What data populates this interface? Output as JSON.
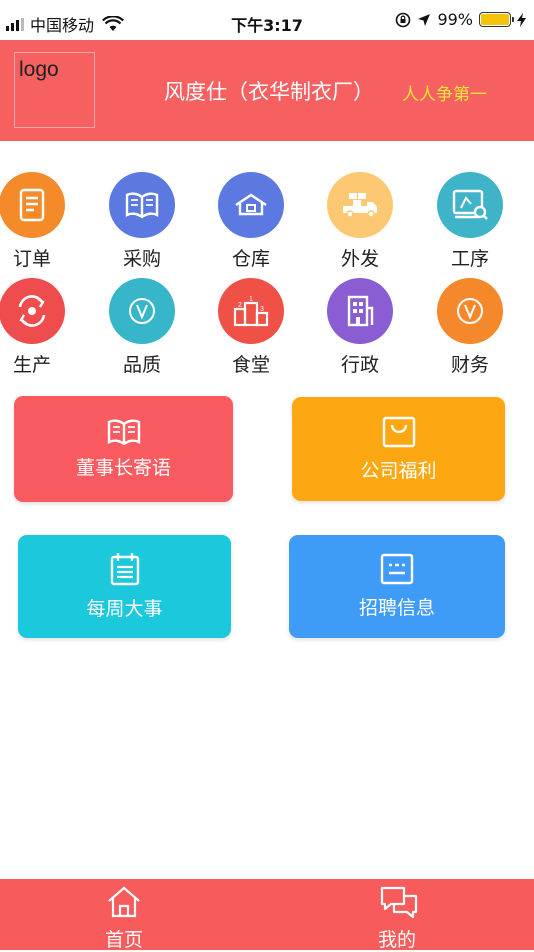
{
  "status_bar": {
    "carrier": "中国移动",
    "time": "下午3:17",
    "battery_percent": "99%"
  },
  "header": {
    "logo_text": "logo",
    "company_name": "风度仕（衣华制衣厂）",
    "slogan": "人人争第一"
  },
  "menu": [
    {
      "label": "订单",
      "icon": "document-icon",
      "color": "#f58a2b"
    },
    {
      "label": "采购",
      "icon": "book-icon",
      "color": "#5b79e0"
    },
    {
      "label": "仓库",
      "icon": "warehouse-icon",
      "color": "#5b79e0"
    },
    {
      "label": "外发",
      "icon": "delivery-truck-icon",
      "color": "#fdc872"
    },
    {
      "label": "工序",
      "icon": "process-monitor-icon",
      "color": "#3fb3c7"
    },
    {
      "label": "生产",
      "icon": "production-cycle-icon",
      "color": "#ef4d4d"
    },
    {
      "label": "品质",
      "icon": "quality-check-icon",
      "color": "#36b6c8"
    },
    {
      "label": "食堂",
      "icon": "canteen-podium-icon",
      "color": "#ef5146"
    },
    {
      "label": "行政",
      "icon": "office-building-icon",
      "color": "#8a5ed2"
    },
    {
      "label": "财务",
      "icon": "finance-check-icon",
      "color": "#f6882c"
    }
  ],
  "cards": [
    {
      "label": "董事长寄语",
      "icon": "open-book-icon",
      "color": "#f95b60"
    },
    {
      "label": "公司福利",
      "icon": "shopping-bag-icon",
      "color": "#fda713"
    },
    {
      "label": "每周大事",
      "icon": "calendar-icon",
      "color": "#1cc8dc"
    },
    {
      "label": "招聘信息",
      "icon": "notice-board-icon",
      "color": "#3e9bf6"
    }
  ],
  "tabbar": {
    "home_label": "首页",
    "mine_label": "我的",
    "background": "#f75b5c"
  }
}
